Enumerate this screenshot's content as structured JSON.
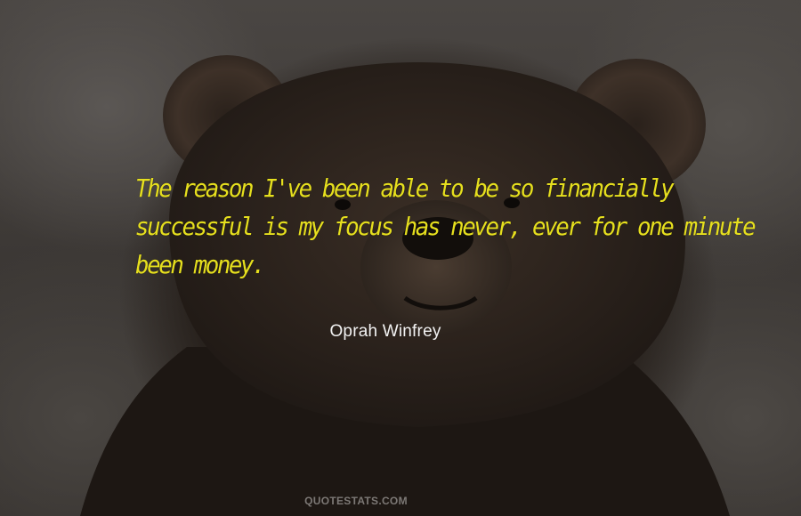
{
  "quote": {
    "lines": [
      "The reason I've been able to be so financially",
      "successful is my focus has never, ever for one minute",
      "been money."
    ],
    "author": "Oprah Winfrey"
  },
  "footer": {
    "watermark": "QUOTESTATS.COM"
  },
  "colors": {
    "quote_text": "#e6df1e",
    "author_text": "#f1f1f1",
    "watermark_text": "#7c7875"
  },
  "image": {
    "background_subject": "bear-face-photo"
  }
}
